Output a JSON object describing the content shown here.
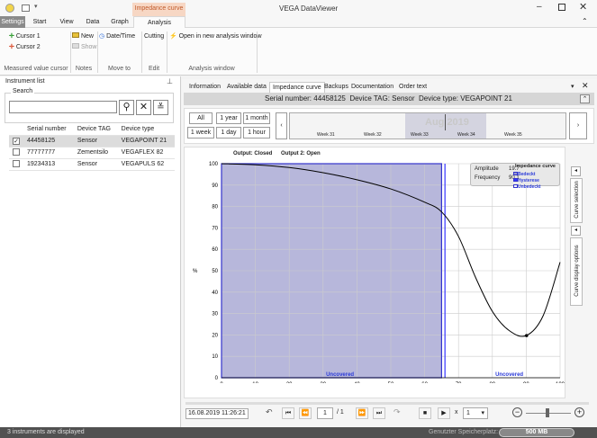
{
  "window": {
    "title": "VEGA DataViewer",
    "context_tab": "Impedance curve"
  },
  "ribbon_tabs": [
    "Settings",
    "Start",
    "View",
    "Data",
    "Graph",
    "Analysis"
  ],
  "ribbon": {
    "cursor1": "Cursor 1",
    "cursor2": "Cursor 2",
    "new": "New",
    "show": "Show",
    "datetime": "Date/Time",
    "cutting": "Cutting",
    "open_window": "Open in new analysis window",
    "groups": [
      "Measured value cursor",
      "Notes",
      "Move to",
      "Edit",
      "Analysis window"
    ]
  },
  "instrument_list": {
    "header": "Instrument list",
    "search_label": "Search",
    "search_value": "",
    "columns": [
      "Serial number",
      "Device TAG",
      "Device type"
    ],
    "rows": [
      {
        "checked": true,
        "serial": "44458125",
        "tag": "Sensor",
        "type": "VEGAPOINT 21"
      },
      {
        "checked": false,
        "serial": "77777777",
        "tag": "Zementsilo",
        "type": "VEGAFLEX 82"
      },
      {
        "checked": false,
        "serial": "19234313",
        "tag": "Sensor",
        "type": "VEGAPULS 62"
      }
    ]
  },
  "panel_tabs": [
    "Information",
    "Available data",
    "Impedance curve",
    "Backups",
    "Documentation",
    "Order text"
  ],
  "device_header": {
    "serial_label": "Serial number:",
    "serial": "44458125",
    "tag_label": "Device TAG:",
    "tag": "Sensor",
    "type_label": "Device type:",
    "type": "VEGAPOINT 21"
  },
  "time_buttons": [
    "All",
    "1 year",
    "1 month",
    "1 week",
    "1 day",
    "1 hour"
  ],
  "timeline": {
    "month": "Aug 2019",
    "weeks": [
      "Week 31",
      "Week 32",
      "Week 33",
      "Week 34",
      "Week 35"
    ]
  },
  "chart_labels": {
    "output1": "Output: Closed",
    "output2": "Output 2: Open",
    "amplitude_label": "Amplitude",
    "amplitude_value": "19.7",
    "frequency_label": "Frequency",
    "frequency_value": "90.1",
    "legend_title": "Impedance curve",
    "legend_items": [
      "Bedeckt",
      "Hysterese",
      "Unbedeckt"
    ],
    "uncovered": "Uncovered"
  },
  "side_tabs": [
    "Curve selection",
    "Curve display options"
  ],
  "playback": {
    "timestamp": "16.08.2019 11:26:21",
    "page": "1",
    "total": "/ 1",
    "speed_prefix": "x",
    "speed": "1"
  },
  "status": {
    "left": "3 instruments are displayed",
    "storage_label": "Genutzter Speicherplatz:",
    "storage_value": "500 MB"
  },
  "chart_data": {
    "type": "line",
    "x": [
      0,
      10,
      20,
      30,
      40,
      50,
      60,
      65,
      70,
      75,
      80,
      85,
      90,
      95,
      100
    ],
    "y": [
      100,
      99.5,
      98.2,
      95.8,
      92.5,
      88.2,
      82,
      77.5,
      66,
      47,
      31,
      22,
      19.7,
      29,
      54
    ],
    "xlim": [
      0,
      100
    ],
    "ylim": [
      0,
      100
    ],
    "xticks": [
      0,
      10,
      20,
      30,
      40,
      50,
      60,
      70,
      80,
      90,
      100
    ],
    "yticks": [
      0,
      10,
      20,
      30,
      40,
      50,
      60,
      70,
      80,
      90,
      100
    ],
    "ylabel": "%",
    "xunit": "%",
    "covered_region": [
      0,
      65
    ],
    "hysteresis_line_x": 66,
    "cursor_x": 90.1,
    "colors": {
      "curve": "#000000",
      "covered": "#9999cc",
      "hysteresis": "#3333ff",
      "cursor": "#000000"
    }
  }
}
